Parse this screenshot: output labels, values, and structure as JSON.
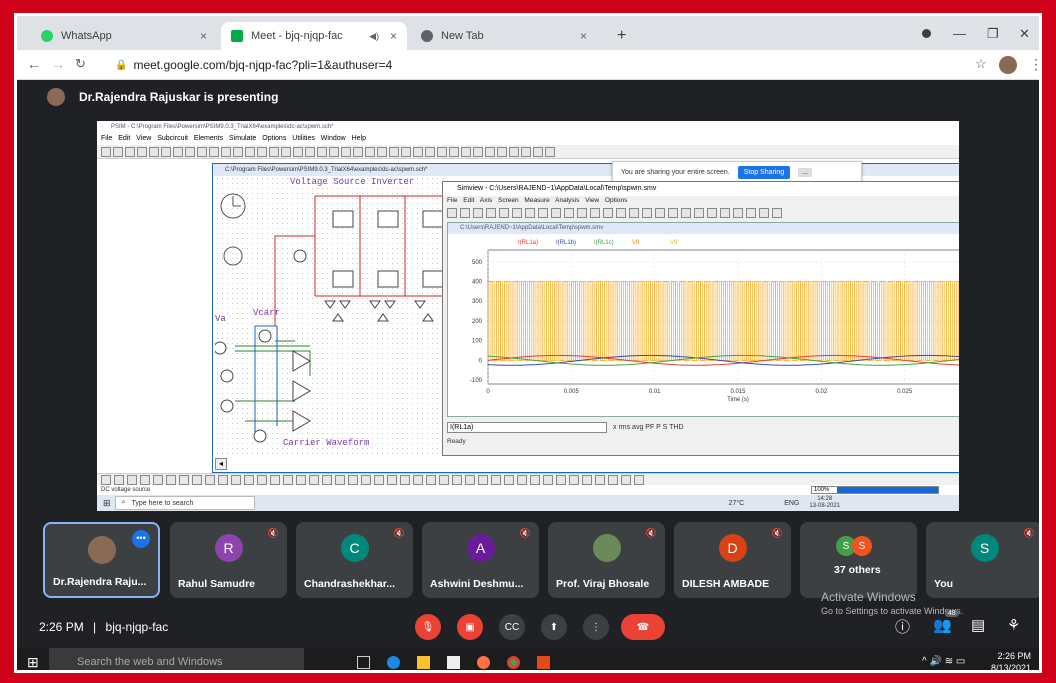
{
  "browser": {
    "tabs": [
      {
        "label": "WhatsApp",
        "close": "×"
      },
      {
        "label": "Meet - bjq-njqp-fac",
        "close": "×"
      },
      {
        "label": "New Tab",
        "close": "×"
      }
    ],
    "new_tab": "+",
    "url": "meet.google.com/bjq-njqp-fac?pli=1&authuser=4",
    "window_controls": [
      "—",
      "❐",
      "✕"
    ]
  },
  "presenting": "Dr.Rajendra Rajuskar is presenting",
  "shared": {
    "psim_title": "PSIM - C:\\Program Files\\Powersim\\PSIM9.0.3_TrialX64\\examples\\dc-ac\\spwm.sch*",
    "psim_menu": "File  Edit  View  Subcircuit  Elements  Simulate  Options  Utilities  Window  Help",
    "share_notice": "You are sharing your entire screen.",
    "stop_sharing": "Stop Sharing",
    "hide": "...",
    "sch_title": "C:\\Program Files\\Powersim\\PSIM9.0.3_TrialX64\\examples\\dc-ac\\spwm.sch*",
    "sch_label_top": "Voltage Source Inverter",
    "sch_label_va": "Va",
    "sch_label_vcarr": "Vcarr",
    "sch_label_carrier": "Carrier Waveform",
    "simview_title": "Simview - C:\\Users\\RAJEND~1\\AppData\\Local\\Temp\\spwm.smv",
    "simview_menu": "File  Edit  Axis  Screen  Measure  Analysis  View  Options",
    "plot_title": "C:\\Users\\RAJEND~1\\AppData\\Local\\Temp\\spwm.smv",
    "var_select": "I(RL1a)",
    "toolbar_text": "x  rms  avg    PF  P  S  THD",
    "simview_status": "Ready",
    "psim_status": "DC voltage source",
    "progress": "100%",
    "progress_fraction": 1.0,
    "win_search": "Type here to search",
    "win_weather": "27°C",
    "win_lang": "ENG",
    "win_time": "14:28",
    "win_date": "13-08-2021"
  },
  "chart_data": {
    "type": "line",
    "legend": [
      "I(RL1a)",
      "I(RL1b)",
      "I(RL1c)",
      "V8",
      "V9"
    ],
    "xlabel": "Time (s)",
    "xticks": [
      "0",
      "0.005",
      "0.01",
      "0.015",
      "0.02",
      "0.025",
      "0.03"
    ],
    "yticks": [
      "500",
      "400",
      "300",
      "200",
      "100",
      "0",
      "-100"
    ],
    "xlim": [
      0,
      0.03
    ],
    "ylim": [
      -120,
      560
    ],
    "pwm_levels": [
      0,
      400
    ],
    "sine_amplitude": 25,
    "colors": {
      "I(RL1a)": "#e53935",
      "I(RL1b)": "#3949ab",
      "I(RL1c)": "#43a047",
      "V8": "#fb8c00",
      "V9": "#ffb300"
    }
  },
  "participants": [
    {
      "name": "Dr.Rajendra Raju...",
      "initial": "",
      "color": "#8a6a55",
      "photo": true
    },
    {
      "name": "Rahul Samudre",
      "initial": "R",
      "color": "#8e44ad"
    },
    {
      "name": "Chandrashekhar...",
      "initial": "C",
      "color": "#00897b"
    },
    {
      "name": "Ashwini Deshmu...",
      "initial": "A",
      "color": "#6a1b9a"
    },
    {
      "name": "Prof. Viraj Bhosale",
      "initial": "",
      "color": "#6a8a5a",
      "photo": true
    },
    {
      "name": "DILESH AMBADE",
      "initial": "D",
      "color": "#d84315"
    },
    {
      "name": "37 others",
      "initial": "",
      "color": "#43a047"
    },
    {
      "name": "You",
      "initial": "S",
      "color": "#00897b"
    }
  ],
  "others_initials": [
    "S",
    "S"
  ],
  "meeting": {
    "time": "2:26 PM",
    "separator": "|",
    "code": "bjq-njqp-fac"
  },
  "activate": {
    "title": "Activate Windows",
    "sub": "Go to Settings to activate Windows."
  },
  "participant_count": "48",
  "taskbar": {
    "search": "Search the web and Windows",
    "time": "2:26 PM",
    "date": "8/13/2021"
  }
}
